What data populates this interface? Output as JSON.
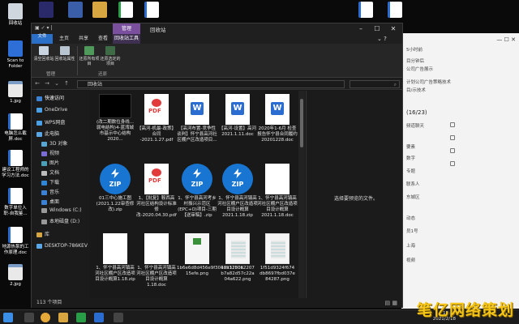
{
  "desktop": {
    "left_icons": [
      {
        "label": "回收站",
        "kind": "bin"
      },
      {
        "label": "Scan to Folder",
        "kind": "app"
      },
      {
        "label": "1.jpg",
        "kind": "img"
      },
      {
        "label": "电脑怎么截屏.doc",
        "kind": "doc"
      },
      {
        "label": "建议工程师的学习方法.doc",
        "kind": "doc"
      },
      {
        "label": "数字单位入职-自我鉴...",
        "kind": "doc"
      },
      {
        "label": "地源热泵的工作原理.doc",
        "kind": "doc"
      },
      {
        "label": "2.jpg",
        "kind": "img"
      }
    ]
  },
  "chat": {
    "lines": [
      "5小时前",
      "目分钟后",
      "公司广告展示",
      "计划公司广告策略技术",
      "目/示技术",
      "(16/23)",
      "频道聊天",
      "要素",
      "数字",
      "专题",
      "联系人",
      "东城区",
      "动态",
      "员1号",
      "上海",
      "视频"
    ],
    "date": "2021/2/18"
  },
  "explorer": {
    "title": "回收站",
    "manage_tab": "管理",
    "tabs": [
      "文件",
      "主页",
      "共享",
      "查看",
      "回收站工具"
    ],
    "ribbon": {
      "buttons": [
        {
          "label": "清空回收站"
        },
        {
          "label": "回收站属性"
        },
        {
          "label": "还原所有项目"
        },
        {
          "label": "还原选定的项目"
        }
      ],
      "groups": [
        "管理",
        "还原"
      ]
    },
    "address": "回收站",
    "nav": [
      {
        "label": "快速访问",
        "icon": "star-icon"
      },
      {
        "label": "OneDrive",
        "icon": "cloud-icon"
      },
      {
        "label": "WPS网盘",
        "icon": "cloud-icon"
      },
      {
        "label": "此电脑",
        "icon": "computer-icon"
      },
      {
        "label": "3D 对象",
        "icon": "cube-icon"
      },
      {
        "label": "视频",
        "icon": "video-icon"
      },
      {
        "label": "图片",
        "icon": "picture-icon"
      },
      {
        "label": "文档",
        "icon": "document-icon"
      },
      {
        "label": "下载",
        "icon": "download-icon"
      },
      {
        "label": "音乐",
        "icon": "music-icon"
      },
      {
        "label": "桌面",
        "icon": "desktop-icon"
      },
      {
        "label": "Windows (C:)",
        "icon": "drive-icon"
      },
      {
        "label": "本地磁盘 (D:)",
        "icon": "drive-icon"
      },
      {
        "label": "库",
        "icon": "library-icon"
      },
      {
        "label": "DESKTOP-786KEV",
        "icon": "network-icon"
      }
    ],
    "files": [
      {
        "name": "(改二期数位身线... 弱电结构)4-蓝湾城市基示中心结构2020...",
        "type": "black"
      },
      {
        "name": "【高河-机最-政策】合同 -2021.1.27.pdf",
        "type": "pdf"
      },
      {
        "name": "【高河布置-竞争性谈判】怀宁县高河社区棚户区改造项目...",
        "type": "doc"
      },
      {
        "name": "【高河-设置】高河 2021.1.11.doc",
        "type": "doc"
      },
      {
        "name": "2020年1-6月 检查报告怀宁县合同履约20201228.doc",
        "type": "blank"
      },
      {
        "name": "01三中心施工图(2021.1.22审查修改).zip",
        "type": "zip"
      },
      {
        "name": "1、【批复】鞍西高河社区结构设计标准修改-2020.04.30.pdf",
        "type": "pdf"
      },
      {
        "name": "1、怀宁县高河考乡村振兴示范区(EPC+O)项目-三期【送审稿】.zip",
        "type": "zip"
      },
      {
        "name": "1、怀宁县高河镇高河社区棚户区改造项目设计概算2021.1.18.zip",
        "type": "zip"
      },
      {
        "name": "1、怀宁县高河镇高河社区棚户区改造项目设计概算2021.1.18.doc",
        "type": "blank"
      },
      {
        "name": "1、怀宁县高河镇高河社区棚户区改造项目设计概算1.18.zip",
        "type": "blank"
      },
      {
        "name": "1、怀宁县高河镇高河社区棚户区改造项目设计概算1.18.doc",
        "type": "blank"
      },
      {
        "name": "1b6e6d8d456e9f3047a17506 15efe.png",
        "type": "green"
      },
      {
        "name": "1d93280a2207 b7a82d57c22a 04a622.png",
        "type": "png"
      },
      {
        "name": "1f51d9324f674 db8697fbd037e 84287.png",
        "type": "png"
      }
    ],
    "preview_text": "选择要预览的文件。",
    "status": "113 个项目"
  },
  "taskbar": {
    "time": "13:37",
    "date": "2021/2/18"
  },
  "watermark": "笔亿网络策划"
}
